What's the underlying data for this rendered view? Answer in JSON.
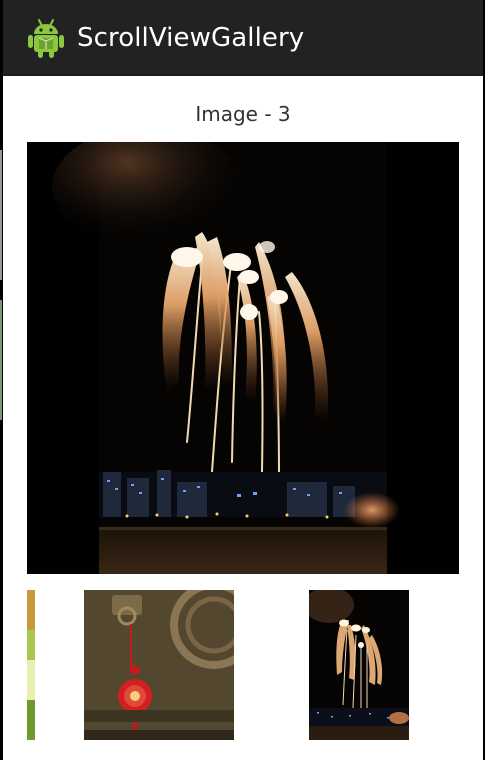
{
  "action_bar": {
    "title": "ScrollViewGallery",
    "icon": "android-robot-icon",
    "background": "#222222",
    "icon_color": "#8DC63F"
  },
  "gallery": {
    "caption": "Image - 3",
    "main_image": "fireworks-image",
    "thumbnails": [
      {
        "image": "green-flowers-image"
      },
      {
        "image": "red-knot-door-image"
      },
      {
        "image": "fireworks-image"
      }
    ]
  }
}
